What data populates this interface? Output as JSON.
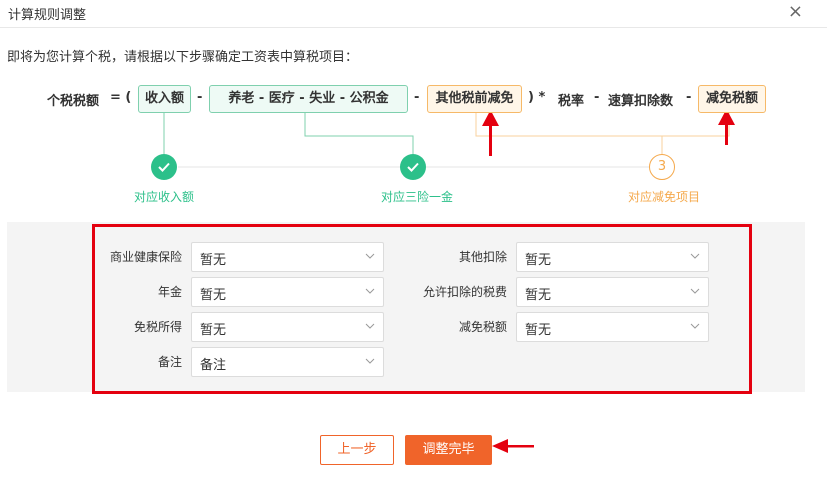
{
  "dialog": {
    "title": "计算规则调整",
    "close_glyph": "×",
    "instruction": "即将为您计算个税，请根据以下步骤确定工资表中算税项目："
  },
  "formula": {
    "lhs": "个税税额",
    "equals_paren": "= (",
    "income": "收入额",
    "minus": "-",
    "insurance": "养老 - 医疗 - 失业 - 公积金",
    "other_deduction": "其他税前减免",
    "close_paren_times": ") *",
    "rate": "税率",
    "quick_deduction": "速算扣除数",
    "exemption": "减免税额"
  },
  "steps": [
    {
      "label": "对应收入额",
      "status": "done",
      "icon": "check-icon"
    },
    {
      "label": "对应三险一金",
      "status": "done",
      "icon": "check-icon"
    },
    {
      "label": "对应减免项目",
      "status": "current",
      "number": "3"
    }
  ],
  "form": {
    "fields": [
      {
        "label": "商业健康保险",
        "value": "暂无"
      },
      {
        "label": "其他扣除",
        "value": "暂无"
      },
      {
        "label": "年金",
        "value": "暂无"
      },
      {
        "label": "允许扣除的税费",
        "value": "暂无"
      },
      {
        "label": "免税所得",
        "value": "暂无"
      },
      {
        "label": "减免税额",
        "value": "暂无"
      },
      {
        "label": "备注",
        "value": "备注"
      }
    ]
  },
  "buttons": {
    "prev": "上一步",
    "done": "调整完毕"
  },
  "colors": {
    "accent": "#f0642a",
    "green": "#2cc08a",
    "orange": "#f5a94c",
    "annotation_red": "#e4000f"
  }
}
